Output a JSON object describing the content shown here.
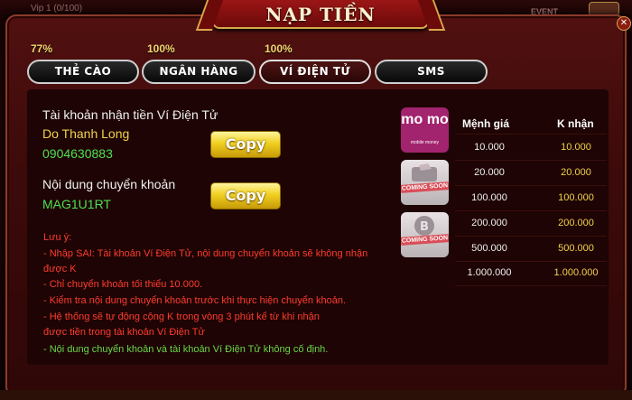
{
  "background": {
    "vip": "Vip 1 (0/100)",
    "event": "EVENT"
  },
  "modal": {
    "title": "NẠP TIỀN"
  },
  "tabs": [
    {
      "label": "THẺ CÀO",
      "bonus": "77%"
    },
    {
      "label": "NGÂN HÀNG",
      "bonus": "100%"
    },
    {
      "label": "VÍ ĐIỆN TỬ",
      "bonus": "100%",
      "active": true
    },
    {
      "label": "SMS"
    }
  ],
  "account": {
    "heading": "Tài khoản nhận tiền Ví Điện Tử",
    "name": "Do Thanh Long",
    "number": "0904630883",
    "copy_label": "Copy"
  },
  "transfer": {
    "heading": "Nội dung chuyển khoản",
    "code": "MAG1U1RT",
    "copy_label": "Copy"
  },
  "notes": {
    "title": "Lưu ý:",
    "lines": [
      "- Nhập SAI: Tài khoản Ví Điện Tử, nội dung chuyển khoản sẽ không nhận",
      "được K",
      "- Chỉ chuyển khoản tối thiểu 10.000.",
      "- Kiểm tra nội dung chuyển khoản trước khi thực hiện chuyển khoản.",
      "- Hệ thống sẽ tự động cộng K trong vòng 3 phút kể từ khi nhận",
      "được tiền trong tài khoản Ví Điện Tử"
    ],
    "fixed": "- Nội dung chuyển khoản và tài khoản Ví Điện Tử không cố định."
  },
  "providers": [
    {
      "name": "mo mo",
      "sub": "mobile money"
    },
    {
      "badge": "COMING SOON"
    },
    {
      "badge": "COMING SOON"
    }
  ],
  "rates": {
    "headers": [
      "Mệnh giá",
      "K nhận"
    ],
    "rows": [
      [
        "10.000",
        "10.000"
      ],
      [
        "20.000",
        "20.000"
      ],
      [
        "100.000",
        "100.000"
      ],
      [
        "200.000",
        "200.000"
      ],
      [
        "500.000",
        "500.000"
      ],
      [
        "1.000.000",
        "1.000.000"
      ]
    ]
  },
  "colors": {
    "accent_gold": "#d7a84a",
    "account_name": "#f2d24c",
    "account_number": "#4fe04f",
    "warning": "#ff3c2e",
    "momo": "#a2236e"
  }
}
